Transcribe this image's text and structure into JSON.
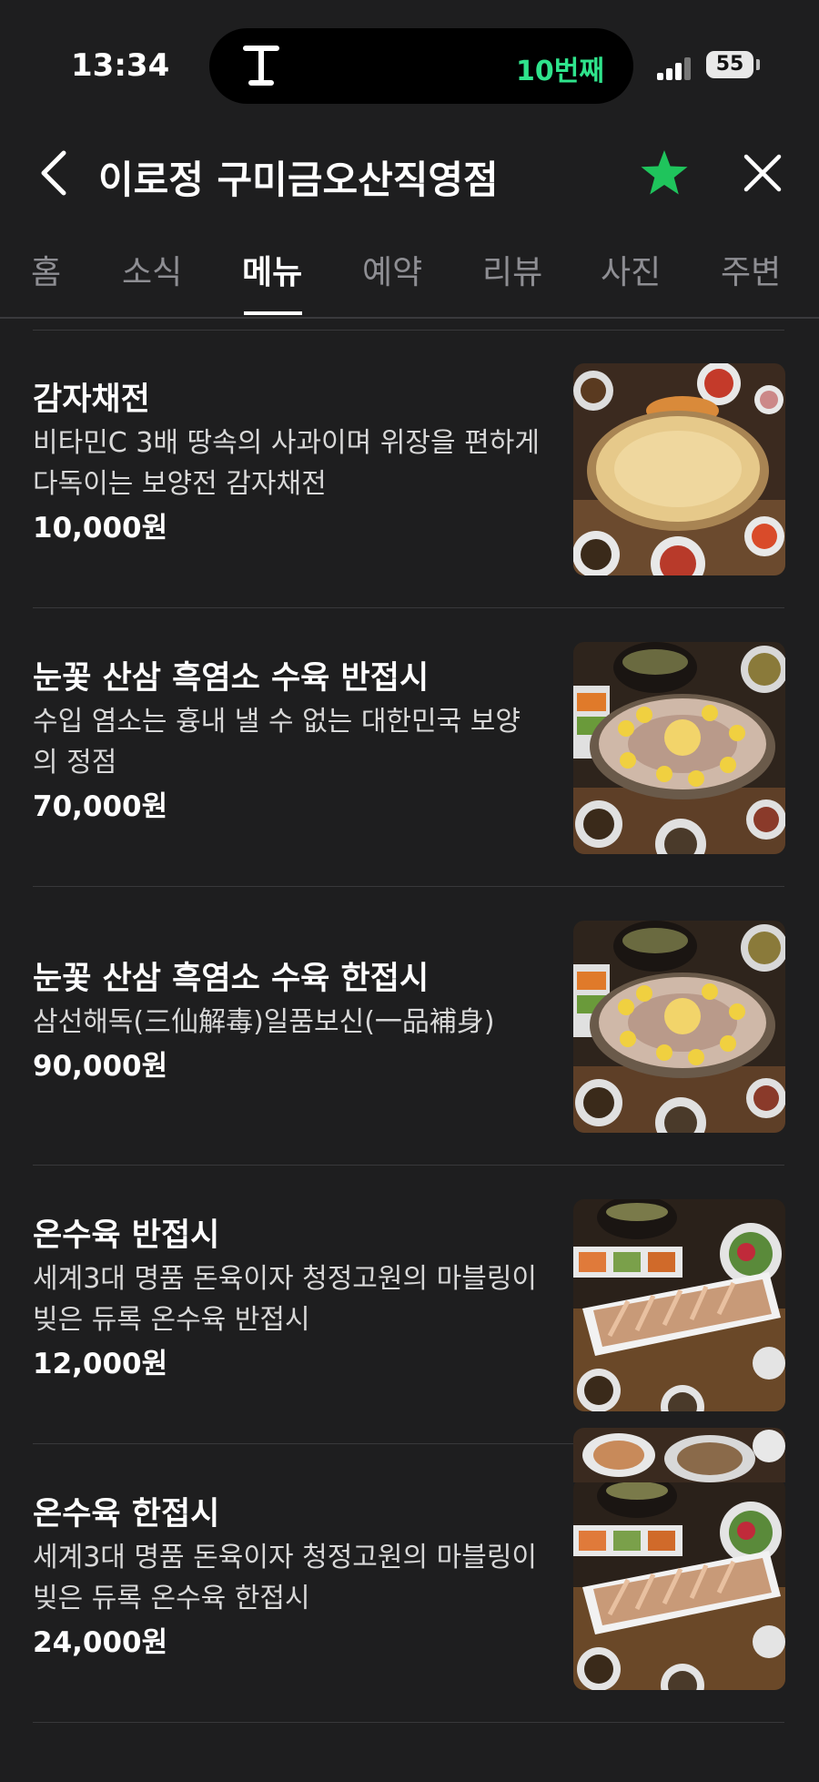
{
  "status_bar": {
    "time": "13:34",
    "island_label": "10번째",
    "battery": "55"
  },
  "header": {
    "title": "이로정 구미금오산직영점"
  },
  "tabs": [
    {
      "label": "홈"
    },
    {
      "label": "소식"
    },
    {
      "label": "메뉴"
    },
    {
      "label": "예약"
    },
    {
      "label": "리뷰"
    },
    {
      "label": "사진"
    },
    {
      "label": "주변"
    }
  ],
  "active_tab": "메뉴",
  "colors": {
    "accent_green": "#2fe48c",
    "star": "#1fc45c",
    "background": "#1e1e1f"
  },
  "icons": [
    "back-arrow-icon",
    "star-icon",
    "close-icon"
  ],
  "menu_items": [
    {
      "name": "감자채전",
      "desc": "비타민C 3배 땅속의 사과이며 위장을 편하게 다독이는 보양전 감자채전",
      "price": "10,000원"
    },
    {
      "name": "눈꽃 산삼 흑염소 수육 반접시",
      "desc": "수입 염소는 흉내 낼 수 없는 대한민국 보양의 정점",
      "price": "70,000원"
    },
    {
      "name": "눈꽃 산삼 흑염소 수육 한접시",
      "desc": "삼선해독(三仙解毒)일품보신(一品補身)",
      "price": "90,000원"
    },
    {
      "name": "온수육 반접시",
      "desc": "세계3대 명품 돈육이자 청정고원의 마블링이 빚은 듀록 온수육 반접시",
      "price": "12,000원"
    },
    {
      "name": "온수육 한접시",
      "desc": "세계3대 명품 돈육이자 청정고원의 마블링이 빚은 듀록 온수육 한접시",
      "price": "24,000원"
    }
  ]
}
